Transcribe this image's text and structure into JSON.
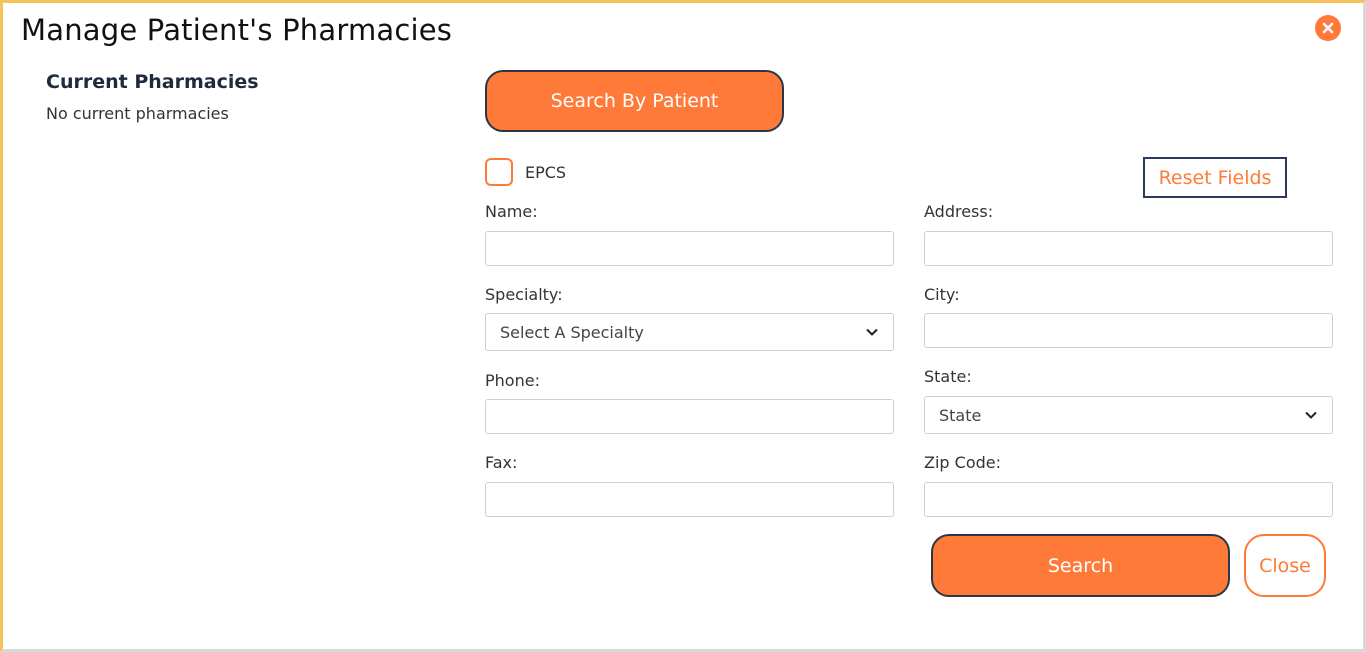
{
  "modal": {
    "title": "Manage Patient's Pharmacies",
    "close_icon": "close-icon"
  },
  "current": {
    "heading": "Current Pharmacies",
    "empty_text": "No current pharmacies"
  },
  "search_by_patient_label": "Search By Patient",
  "epcs": {
    "label": "EPCS",
    "checked": false
  },
  "reset_label": "Reset Fields",
  "fields": {
    "name": {
      "label": "Name:",
      "value": ""
    },
    "address": {
      "label": "Address:",
      "value": ""
    },
    "specialty": {
      "label": "Specialty:",
      "selected": "Select A Specialty"
    },
    "city": {
      "label": "City:",
      "value": ""
    },
    "phone": {
      "label": "Phone:",
      "value": ""
    },
    "state": {
      "label": "State:",
      "selected": "State"
    },
    "fax": {
      "label": "Fax:",
      "value": ""
    },
    "zip": {
      "label": "Zip Code:",
      "value": ""
    }
  },
  "actions": {
    "search_label": "Search",
    "close_label": "Close"
  },
  "colors": {
    "accent": "#ff7a38",
    "border_dark": "#2b3646",
    "frame": "#f6c35b"
  }
}
